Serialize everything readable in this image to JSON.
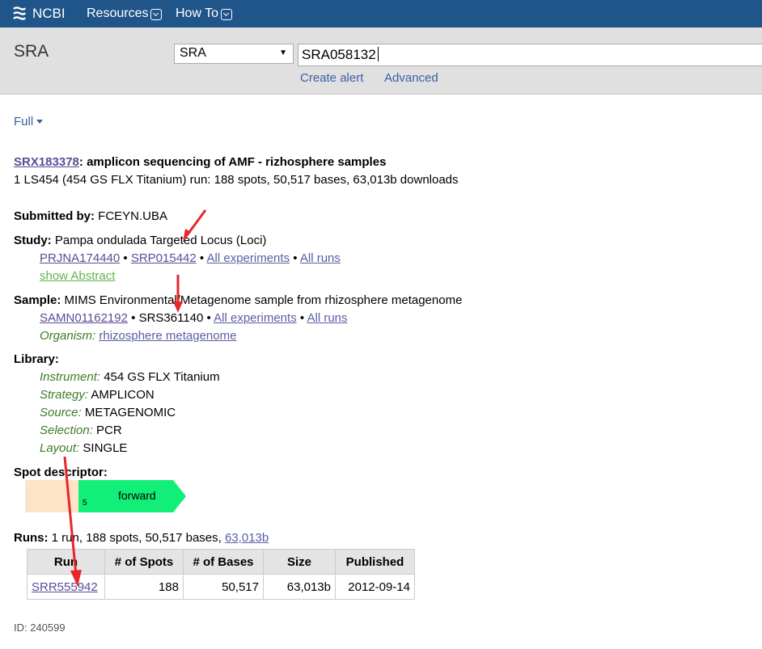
{
  "topbar": {
    "logo_text": "NCBI",
    "menus": [
      "Resources",
      "How To"
    ]
  },
  "search": {
    "db_title": "SRA",
    "db_selected": "SRA",
    "term": "SRA058132",
    "links": [
      "Create alert",
      "Advanced"
    ]
  },
  "display": {
    "format": "Full"
  },
  "experiment": {
    "accession": "SRX183378",
    "title": ": amplicon sequencing of AMF - rizhosphere samples",
    "summary": "1 LS454 (454 GS FLX Titanium) run: 188 spots, 50,517 bases, 63,013b downloads"
  },
  "submitted": {
    "label": "Submitted by:",
    "value": "FCEYN.UBA"
  },
  "study": {
    "label": "Study:",
    "value": "Pampa ondulada Targeted Locus (Loci)",
    "bioproject": "PRJNA174440",
    "srp": "SRP015442",
    "all_experiments": "All experiments",
    "all_runs": "All runs",
    "show_abstract": "show Abstract",
    "sep": "•"
  },
  "sample": {
    "label": "Sample:",
    "value": "MIMS Environmental/Metagenome sample from rhizosphere metagenome",
    "biosample": "SAMN01162192",
    "srs": "SRS361140",
    "all_experiments": "All experiments",
    "all_runs": "All runs",
    "organism_label": "Organism:",
    "organism": "rhizosphere metagenome"
  },
  "library": {
    "label": "Library:",
    "fields": [
      {
        "k": "Instrument:",
        "v": "454 GS FLX Titanium"
      },
      {
        "k": "Strategy:",
        "v": "AMPLICON"
      },
      {
        "k": "Source:",
        "v": "METAGENOMIC"
      },
      {
        "k": "Selection:",
        "v": "PCR"
      },
      {
        "k": "Layout:",
        "v": "SINGLE"
      }
    ]
  },
  "spot": {
    "label": "Spot descriptor:",
    "forward": "forward",
    "num": "5",
    "colors": {
      "adapter": "#fde3c7",
      "read": "#12ef78"
    }
  },
  "runs": {
    "label": "Runs:",
    "summary": "1 run, 188 spots, 50,517 bases,",
    "download": "63,013b",
    "headers": [
      "Run",
      "# of Spots",
      "# of Bases",
      "Size",
      "Published"
    ],
    "rows": [
      [
        "SRR555942",
        "188",
        "50,517",
        "63,013b",
        "2012-09-14"
      ]
    ]
  },
  "footer": {
    "id_text": "ID: 240599"
  },
  "colors": {
    "topbar": "#20558a",
    "link": "#5c4b96",
    "green_link": "#63b34b",
    "arrow": "#e8262b"
  }
}
